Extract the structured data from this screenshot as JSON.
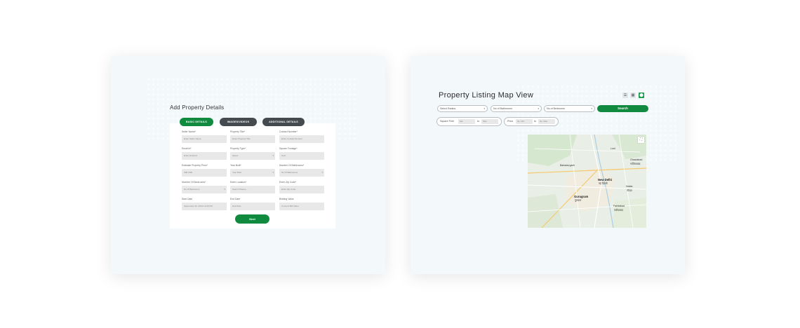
{
  "add_property": {
    "title": "Add Property Details",
    "tabs": [
      {
        "label": "BASIC DETAILS",
        "active": true
      },
      {
        "label": "IMAGES/VIDEOS",
        "active": false
      },
      {
        "label": "ADDITIONAL DETAILS",
        "active": false
      }
    ],
    "fields": [
      {
        "label": "Seller Name*",
        "value": "Enter Seller Name"
      },
      {
        "label": "Property Title*",
        "value": "Enter Property Title"
      },
      {
        "label": "Contact Number*",
        "value": "Enter Contact Number"
      },
      {
        "label": "Email Id*",
        "value": "Enter Email Id"
      },
      {
        "label": "Property Type*",
        "value": "Select"
      },
      {
        "label": "Square Footage*",
        "value": "Sq.ft"
      },
      {
        "label": "Estimate Property Price*",
        "value": "INR US$"
      },
      {
        "label": "Year Built*",
        "value": "Year Built"
      },
      {
        "label": "Number Of Bathrooms*",
        "value": "No Of Bathrooms"
      },
      {
        "label": "Number Of Bedrooms*",
        "value": "No Of Bedrooms"
      },
      {
        "label": "Enter Location*",
        "value": "Search Places..."
      },
      {
        "label": "Enter Zip Code*",
        "value": "Enter Zip Code"
      },
      {
        "label": "Start Date",
        "value": "September 20, 2019 12:00 PM"
      },
      {
        "label": "End Date",
        "value": "End Date"
      },
      {
        "label": "Bidding Value",
        "value": "Connect Bid Value"
      }
    ],
    "next_label": "Next"
  },
  "map_view": {
    "title": "Property Listing Map View",
    "view_icons": [
      "list-icon",
      "grid-icon",
      "map-pin-icon"
    ],
    "filters": {
      "radius": "Select Radius",
      "bathrooms": "No of Bathrooms",
      "bedrooms": "No of Bedrooms",
      "search_label": "Search",
      "sqft_label": "Square Feet",
      "sqft_min": "Min",
      "sqft_to": "to",
      "sqft_max": "Max",
      "price_label": "Price",
      "price_min": "No. Min",
      "price_to": "to",
      "price_max": "No. Max"
    },
    "map_labels": {
      "ghaziabad": "Ghaziabad",
      "ghaziabad_hi": "गाज़ियाबाद",
      "new_delhi": "New Delhi",
      "new_delhi_hi": "नई दिल्ली",
      "noida": "Noida",
      "noida_hi": "नोएडा",
      "gurugram": "Gurugram",
      "gurugram_hi": "गुरुग्राम",
      "faridabad": "Faridabad",
      "faridabad_hi": "फरीदाबाद",
      "bahadurgarh": "Bahadurgarh",
      "loni": "Loni"
    }
  },
  "colors": {
    "accent": "#0f8a3f",
    "dark_tab": "#444a4e",
    "card_bg": "#f3f8fa"
  }
}
